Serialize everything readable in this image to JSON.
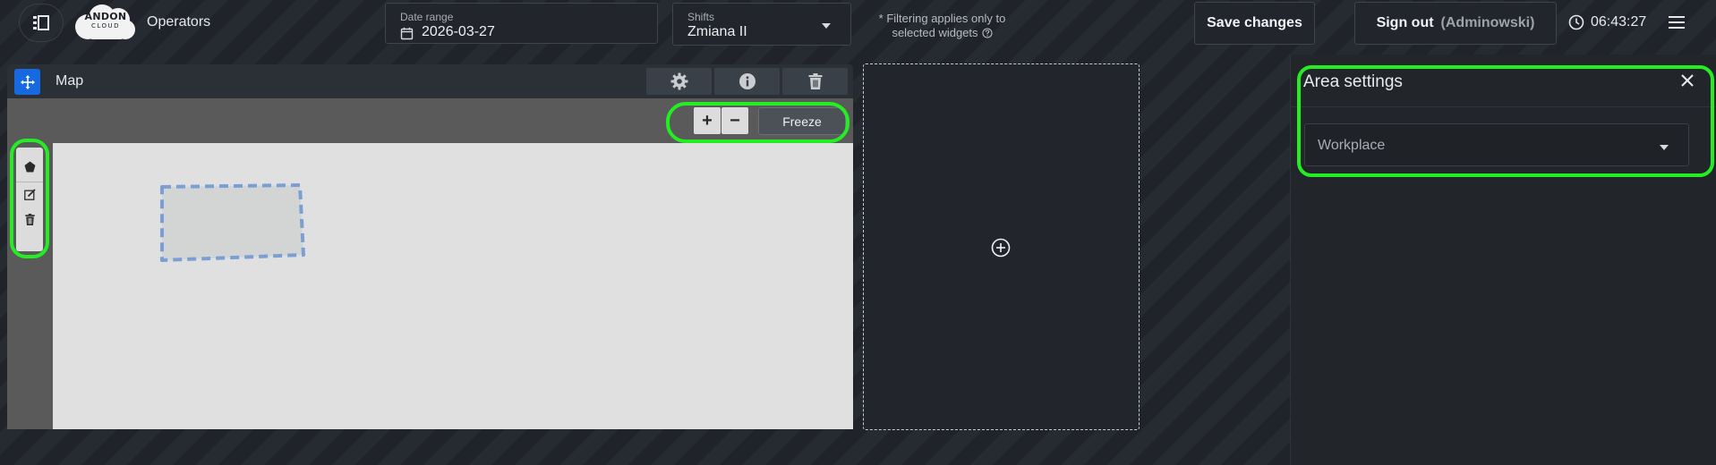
{
  "header": {
    "page_title": "Operators",
    "logo_text": "ANDON",
    "logo_subtext": "CLOUD",
    "date_range": {
      "label": "Date range",
      "value": "2026-03-27"
    },
    "shifts": {
      "label": "Shifts",
      "value": "Zmiana II"
    },
    "filter_note_line1": "* Filtering applies only to",
    "filter_note_line2": "selected widgets",
    "save_label": "Save changes",
    "sign_out_label": "Sign out",
    "sign_out_user": "(Adminowski)",
    "clock": "06:43:27"
  },
  "map_widget": {
    "title": "Map",
    "zoom_in_label": "+",
    "zoom_out_label": "−",
    "freeze_label": "Freeze"
  },
  "area_settings": {
    "title": "Area settings",
    "workplace_placeholder": "Workplace"
  },
  "colors": {
    "accent_blue": "#1769e0",
    "highlight_green": "#22ee22",
    "area_outline": "#7b9fd4"
  },
  "icons": {
    "menu_toggle": "sidebar-toggle-icon",
    "calendar": "calendar-icon",
    "clock": "clock-icon",
    "hamburger": "hamburger-menu-icon",
    "move": "move-icon",
    "settings": "gear-icon",
    "info": "info-icon",
    "delete": "trash-icon",
    "polygon": "polygon-icon",
    "edit": "edit-icon",
    "add": "plus-circle-icon",
    "close": "close-icon"
  }
}
